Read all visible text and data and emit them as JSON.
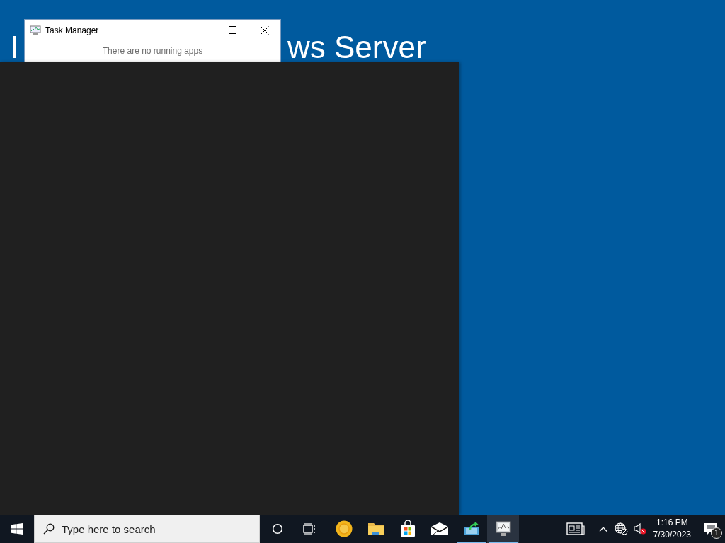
{
  "desktop": {
    "heading_fragments": [
      "I",
      "ws Server"
    ]
  },
  "window": {
    "title": "Task Manager",
    "message": "There are no running apps"
  },
  "taskbar": {
    "search": {
      "placeholder": "Type here to search"
    },
    "apps": [
      {
        "kind": "cortana",
        "running": false,
        "active": false
      },
      {
        "kind": "task-view",
        "running": false,
        "active": false
      },
      {
        "kind": "browser",
        "running": false,
        "active": false
      },
      {
        "kind": "folder",
        "running": false,
        "active": false
      },
      {
        "kind": "store",
        "running": false,
        "active": false
      },
      {
        "kind": "mail",
        "running": false,
        "active": false
      },
      {
        "kind": "setup",
        "running": true,
        "active": false
      },
      {
        "kind": "monitor",
        "running": true,
        "active": true
      }
    ],
    "tray": {
      "volume_muted": true,
      "clock_time": "1:16 PM",
      "clock_date": "7/30/2023",
      "notification_count": "1"
    }
  }
}
